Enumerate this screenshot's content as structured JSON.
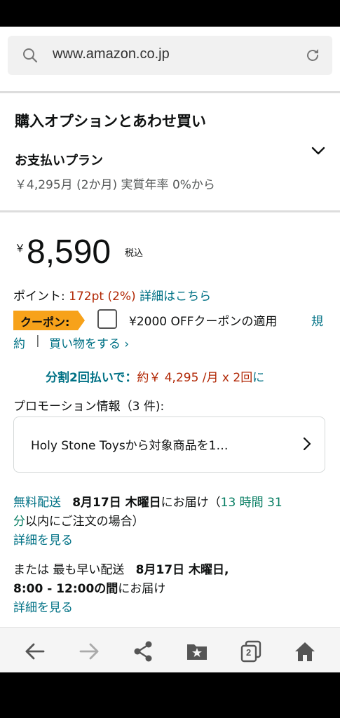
{
  "browser": {
    "url": "www.amazon.co.jp"
  },
  "purchase": {
    "title": "購入オプションとあわせ買い",
    "plan_label": "お支払いプラン",
    "plan_sub": "￥4,295月 (2か月) 実質年率 0%から"
  },
  "price": {
    "symbol": "￥",
    "amount": "8,590",
    "tax": "税込"
  },
  "points": {
    "label": "ポイント: ",
    "value": "172pt",
    "pct": "(2%)",
    "link": "詳細はこちら"
  },
  "coupon": {
    "badge": "クーポン:",
    "text": "¥2000 OFFクーポンの適用",
    "terms_part1": "規",
    "terms_part2": "約",
    "separator": "|",
    "shop_link": "買い物をする ›"
  },
  "installment": {
    "label": "分割2回払いで：",
    "prefix": "約￥ 4,295 /月 x 2回",
    "suffix": "に"
  },
  "promo": {
    "label": "プロモーション情報（3 件):",
    "text": "Holy Stone Toysから対象商品を1…"
  },
  "delivery": {
    "free_label": "無料配送",
    "date": "8月17日 木曜日",
    "deliver_suffix": "にお届け（",
    "countdown_a": "13 時間 31",
    "countdown_b": "分",
    "order_suffix": "以内にご注文の場合）",
    "details_link": "詳細を見る",
    "fast_prefix": "または 最も早い配送",
    "fast_date": "8月17日 木曜日,",
    "fast_time": "8:00 - 12:00の間",
    "fast_suffix": "にお届け",
    "details_link2": "詳細を見る"
  },
  "nav": {
    "tabs_count": "2",
    "icons": [
      "back-icon",
      "forward-icon",
      "share-icon",
      "bookmark-icon",
      "tabs-icon",
      "home-icon"
    ]
  },
  "colors": {
    "accent_teal": "#007185",
    "price_red": "#b12704",
    "coupon_orange": "#f7a21a",
    "countdown_green": "#067d62"
  }
}
